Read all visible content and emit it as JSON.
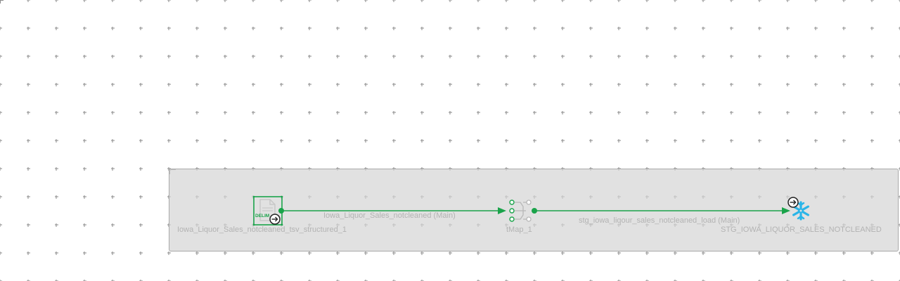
{
  "canvas": {
    "background": "#ffffff",
    "grid_color": "#8a8a8a",
    "subjob_color": "#d6d6d6",
    "link_color": "#1aa34a"
  },
  "nodes": {
    "source": {
      "icon": "delimited-file-icon",
      "icon_text": "DELIM",
      "label": "Iowa_Liquor_Sales_notcleaned_tsv_structured_1"
    },
    "tmap": {
      "icon": "tmap-icon",
      "label": "tMap_1"
    },
    "target": {
      "icon": "snowflake-icon",
      "label": "STG_IOWA_LIQUOR_SALES_NOTCLEANED"
    }
  },
  "links": {
    "main_1": {
      "label": "Iowa_Liquor_Sales_notcleaned (Main)"
    },
    "main_2": {
      "label": "stg_iowa_liqour_sales_notcleaned_load (Main)"
    }
  }
}
